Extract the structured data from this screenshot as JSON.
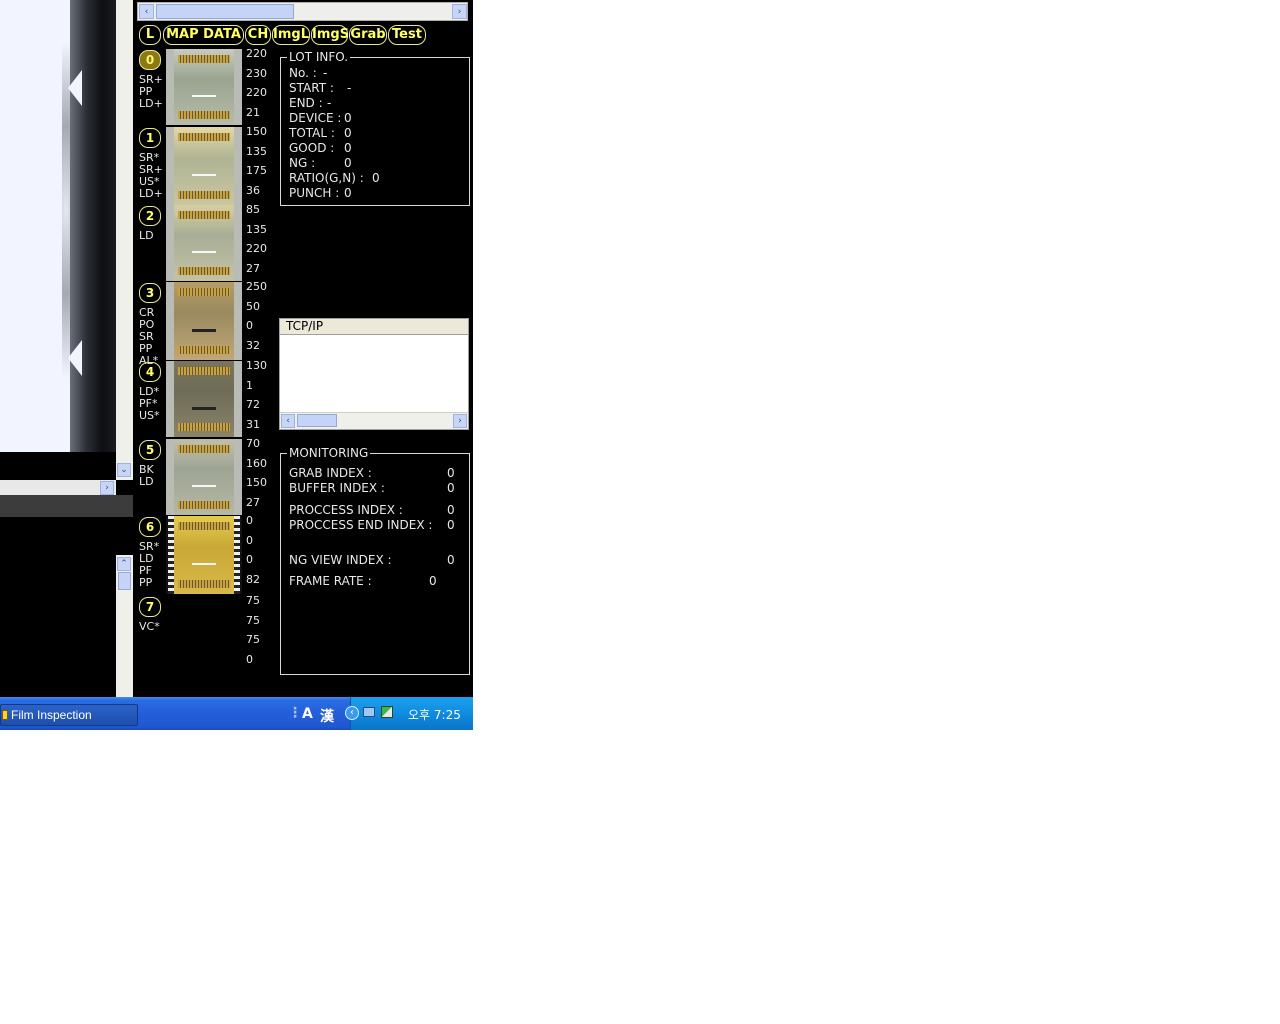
{
  "tabs": [
    "L",
    "MAP DATA",
    "CH",
    "ImgL",
    "ImgS",
    "Grab",
    "Test"
  ],
  "slots": [
    {
      "label": "0",
      "codes": "SR+\nPP\nLD+",
      "values": [
        "220",
        "230",
        "220",
        "21"
      ],
      "active": true
    },
    {
      "label": "1",
      "codes": "SR*\nSR+\nUS*\nLD+",
      "values": [
        "150",
        "135",
        "175",
        "36"
      ],
      "active": false
    },
    {
      "label": "2",
      "codes": "LD",
      "values": [
        "85",
        "135",
        "220",
        "27"
      ],
      "active": false
    },
    {
      "label": "3",
      "codes": "CR\nPO\nSR\nPP\nAL*",
      "values": [
        "250",
        "50",
        "0",
        "32"
      ],
      "active": false
    },
    {
      "label": "4",
      "codes": "LD*\nPF*\nUS*",
      "values": [
        "130",
        "1",
        "72",
        "31"
      ],
      "active": false
    },
    {
      "label": "5",
      "codes": "BK\nLD",
      "values": [
        "70",
        "160",
        "150",
        "27"
      ],
      "active": false
    },
    {
      "label": "6",
      "codes": "SR*\nLD\nPF\nPP",
      "values": [
        "0",
        "0",
        "0",
        "82"
      ],
      "active": false
    },
    {
      "label": "7",
      "codes": "VC*",
      "values": [
        "75",
        "75",
        "75",
        "0"
      ],
      "active": false
    }
  ],
  "lot_info": {
    "title": "LOT INFO.",
    "lines": [
      {
        "label": "No. :",
        "value": "-"
      },
      {
        "label": "START :",
        "value": "-"
      },
      {
        "label": "END :",
        "value": "-"
      },
      {
        "label": "DEVICE :",
        "value": "0"
      },
      {
        "label": "TOTAL :",
        "value": "0"
      },
      {
        "label": "GOOD :",
        "value": "0"
      },
      {
        "label": "NG :",
        "value": "0"
      },
      {
        "label": "RATIO(G,N) :",
        "value": "0"
      },
      {
        "label": "PUNCH :",
        "value": "0"
      }
    ]
  },
  "tcp": {
    "title": "TCP/IP"
  },
  "monitoring": {
    "title": "MONITORING",
    "grab_index_label": "GRAB INDEX :",
    "grab_index": "0",
    "buffer_index_label": "BUFFER INDEX :",
    "buffer_index": "0",
    "process_index_label": "PROCCESS INDEX :",
    "process_index": "0",
    "process_end_label": "PROCCESS END INDEX :",
    "process_end": "0",
    "ng_view_label": "NG VIEW INDEX :",
    "ng_view": "0",
    "frame_rate_label": "FRAME RATE :",
    "frame_rate": "0"
  },
  "taskbar": {
    "app_button": "Film Inspection",
    "lang_a": "A",
    "lang_han": "漢",
    "clock": "오후 7:25"
  },
  "colors": {
    "tab_text": "#ffff66",
    "taskbar": "#245edb",
    "tray": "#0f8be0"
  }
}
